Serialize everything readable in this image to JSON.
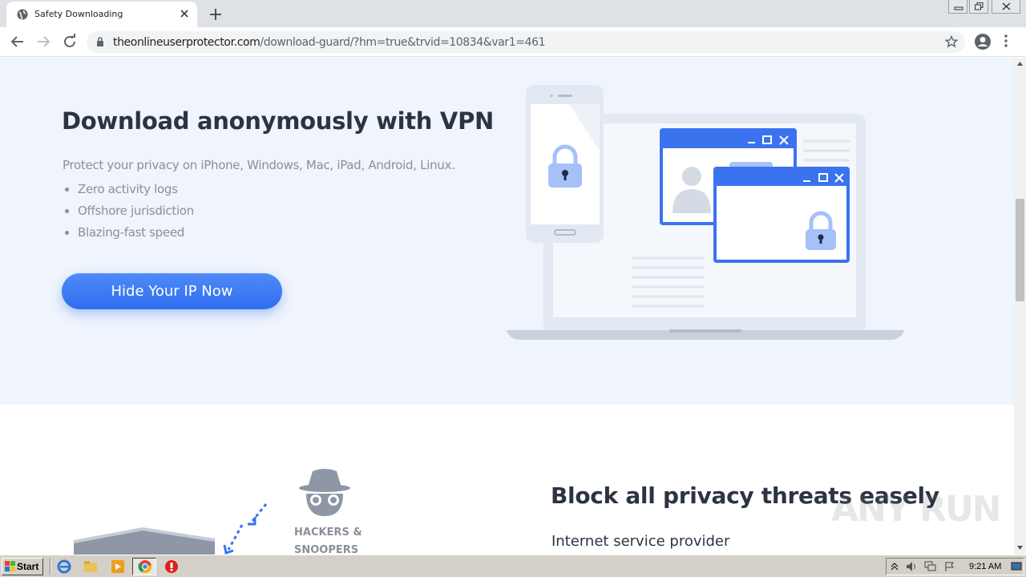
{
  "browser": {
    "tab_title": "Safety Downloading",
    "url_host": "theonlineuserprotector.com",
    "url_path": "/download-guard/?hm=true&trvid=10834&var1=461"
  },
  "hero": {
    "title": "Download anonymously with VPN",
    "subtitle": "Protect your privacy on iPhone, Windows, Mac, iPad, Android, Linux.",
    "features": [
      "Zero activity logs",
      "Offshore jurisdiction",
      "Blazing-fast speed"
    ],
    "cta_label": "Hide Your IP Now"
  },
  "section2": {
    "title": "Block all privacy threats easely",
    "first_item": "Internet service provider",
    "hackers_label_line1": "HACKERS &",
    "hackers_label_line2": "SNOOPERS"
  },
  "watermark": "ANY RUN",
  "taskbar": {
    "start_label": "Start",
    "clock": "9:21 AM"
  },
  "colors": {
    "accent": "#3a76f3",
    "hero_bg": "#eff4fd",
    "heading": "#2c3442"
  }
}
